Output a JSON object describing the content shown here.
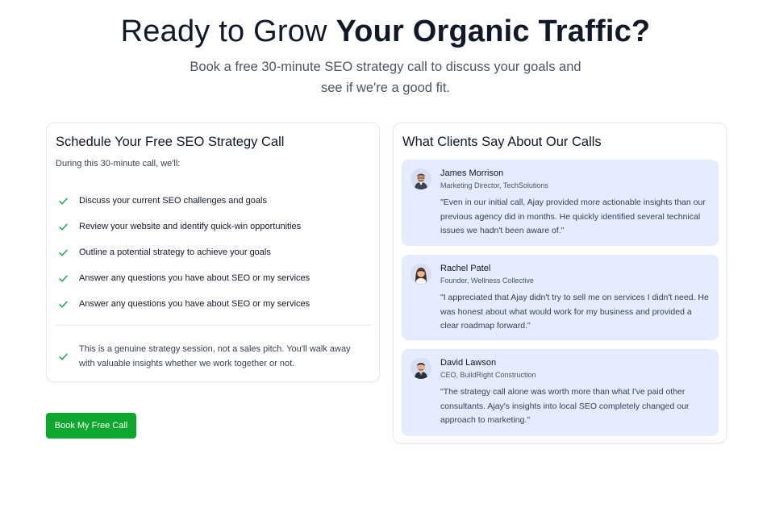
{
  "hero": {
    "title_regular": "Ready to Grow ",
    "title_bold": "Your Organic Traffic?",
    "subtitle": "Book a free 30-minute SEO strategy call to discuss your goals and see if we're a good fit."
  },
  "schedule": {
    "title": "Schedule Your Free SEO Strategy Call",
    "intro": "During this 30-minute call, we'll:",
    "items": [
      "Discuss your current SEO challenges and goals",
      "Review your website and identify quick-win opportunities",
      "Outline a potential strategy to achieve your goals",
      "Answer any questions you have about SEO or my services",
      "Answer any questions you have about SEO or my services"
    ],
    "note": "This is a genuine strategy session, not a sales pitch. You'll walk away with valuable insights whether we work together or not.",
    "check_icon": "check-icon",
    "check_color": "#16a34a"
  },
  "cta": {
    "label": "Book My Free Call",
    "color": "#0fa82e"
  },
  "testimonials": {
    "title": "What Clients Say About Our Calls",
    "items": [
      {
        "name": "James Morrison",
        "role": "Marketing Director, TechSolutions",
        "quote": "\"Even in our initial call, Ajay provided more actionable insights than our previous agency did in months. He quickly identified several technical issues we hadn't been aware of.\""
      },
      {
        "name": "Rachel Patel",
        "role": "Founder, Wellness Collective",
        "quote": "\"I appreciated that Ajay didn't try to sell me on services I didn't need. He was honest about what would work for my business and provided a clear roadmap forward.\""
      },
      {
        "name": "David Lawson",
        "role": "CEO, BuildRight Construction",
        "quote": "\"The strategy call alone was worth more than what I've paid other consultants. Ajay's insights into local SEO completely changed our approach to marketing.\""
      }
    ],
    "card_bg": "#e4ecfd"
  }
}
